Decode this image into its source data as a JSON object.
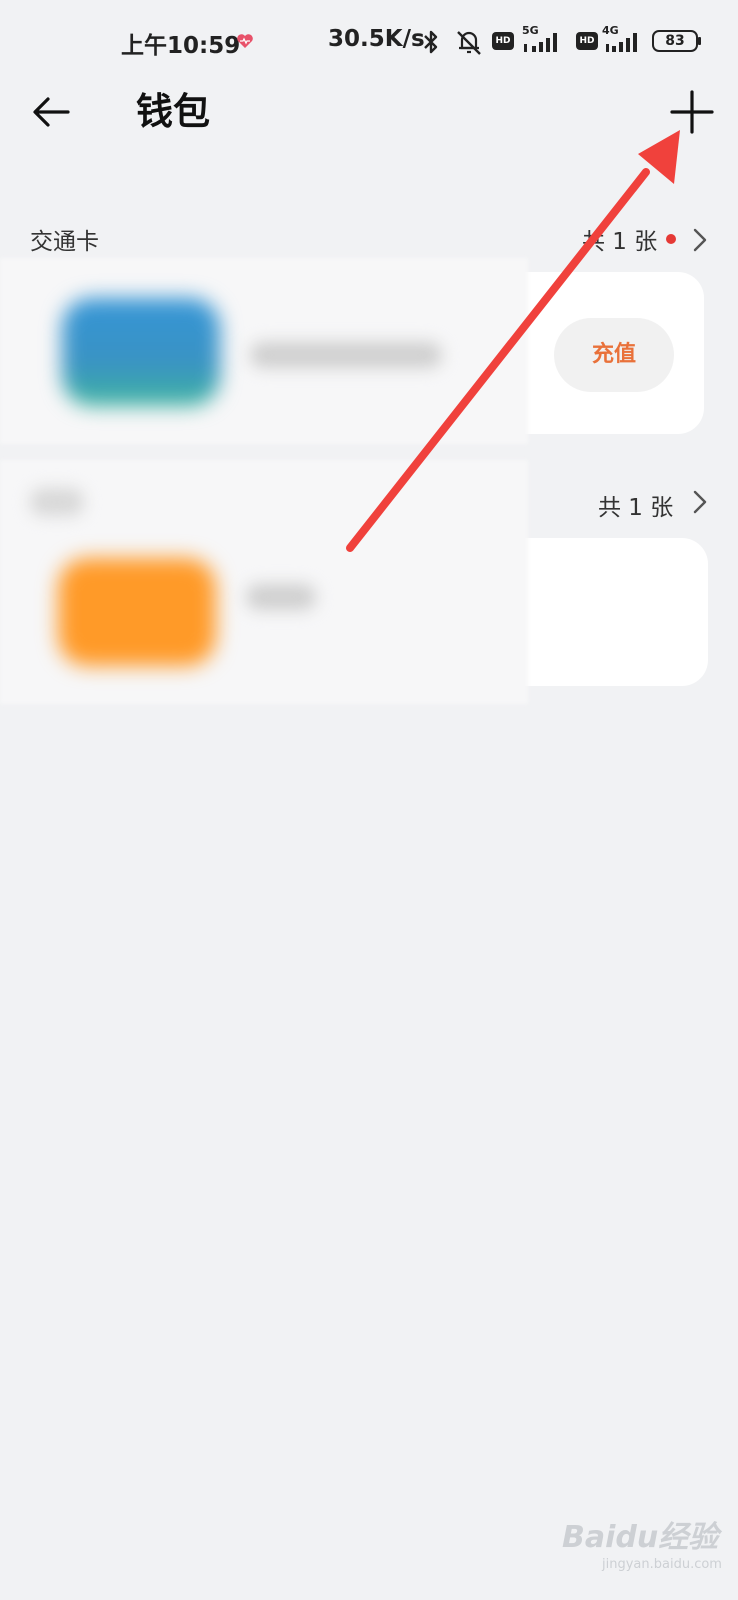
{
  "status_bar": {
    "time": "上午10:59",
    "net_speed": "30.5K/s",
    "hd_label": "HD",
    "net_5g": "5G",
    "net_4g": "4G",
    "battery": "83"
  },
  "header": {
    "title": "钱包"
  },
  "sections": [
    {
      "label": "交通卡",
      "count": "共 1 张",
      "has_notification_dot": true,
      "action_label": "充值"
    },
    {
      "label": "",
      "count": "共 1 张",
      "has_notification_dot": false
    }
  ],
  "watermark": {
    "main": "Baidu经验",
    "sub": "jingyan.baidu.com"
  },
  "colors": {
    "background": "#f1f2f4",
    "card": "#ffffff",
    "accent_orange": "#e9713a",
    "notification_red": "#e53935",
    "annotation_arrow": "#f0413c",
    "card1_thumb": "#3a95cc",
    "card2_thumb": "#ff9a28"
  }
}
